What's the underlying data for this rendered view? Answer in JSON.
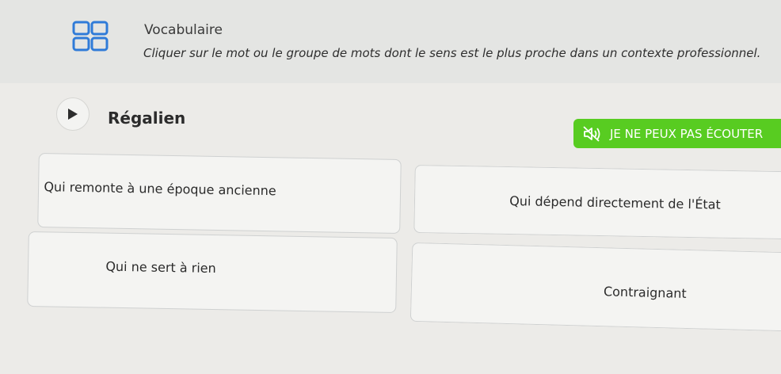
{
  "header": {
    "title": "Vocabulaire",
    "instruction": "Cliquer sur le mot ou le groupe de mots dont le sens est le plus proche dans un contexte professionnel.",
    "icon": "vocabulary-grid-icon",
    "icon_color": "#2f7bd8"
  },
  "question": {
    "word": "Régalien",
    "play_icon": "play-icon"
  },
  "actions": {
    "cannot_listen_label": "JE NE PEUX PAS ÉCOUTER",
    "cannot_listen_icon": "muted-speaker-icon",
    "accent_color": "#58cc21"
  },
  "choices": [
    {
      "label": "Qui remonte à une époque ancienne"
    },
    {
      "label": "Qui dépend directement de l'État"
    },
    {
      "label": "Qui ne sert à rien"
    },
    {
      "label": "Contraignant"
    }
  ]
}
